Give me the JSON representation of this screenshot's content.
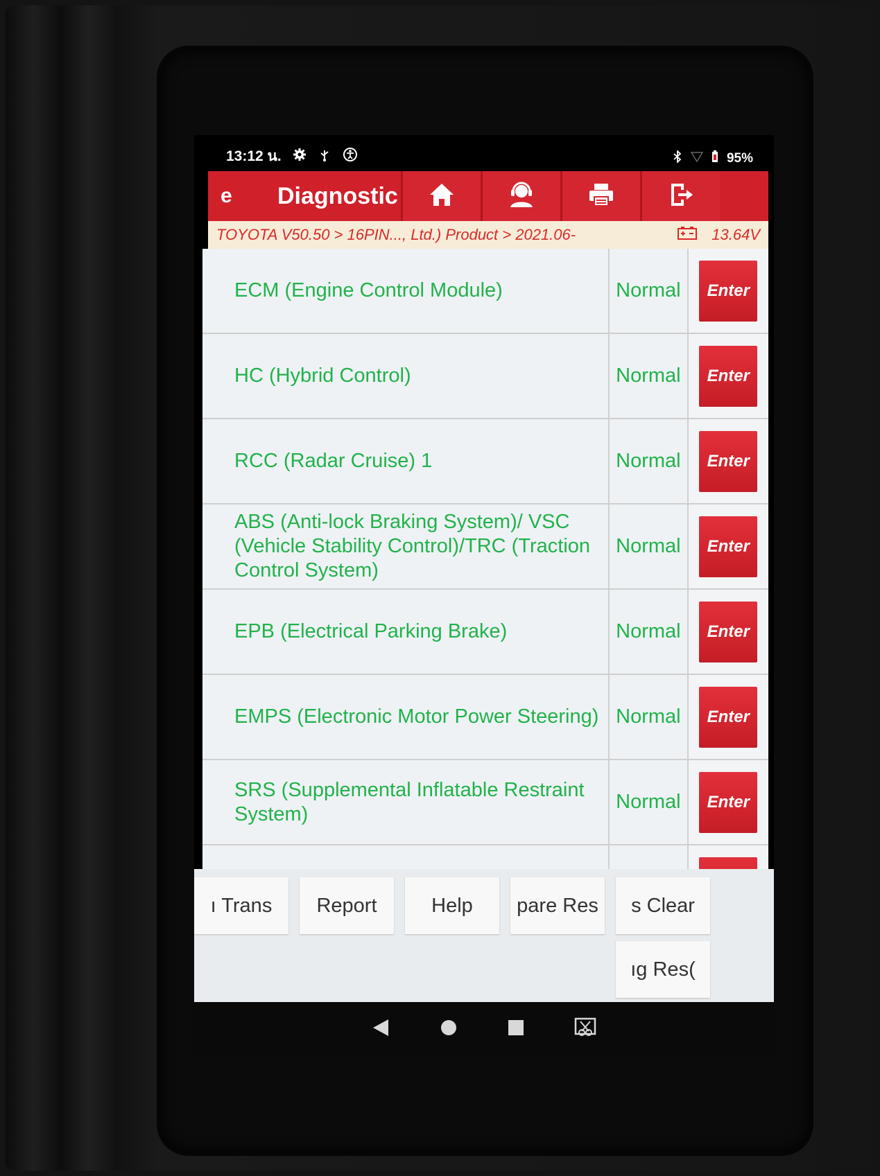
{
  "status_bar": {
    "time": "13:12 น.",
    "battery": "95%"
  },
  "app_bar": {
    "back_fragment": "e",
    "title": "Diagnostic",
    "icons": [
      "home-icon",
      "support-icon",
      "print-icon",
      "exit-icon"
    ]
  },
  "breadcrumb": {
    "path": "TOYOTA V50.50 > 16PIN..., Ltd.) Product > 2021.06-",
    "voltage": "13.64V"
  },
  "systems": [
    {
      "name": "ECM (Engine Control Module)",
      "status": "Normal",
      "action": "Enter"
    },
    {
      "name": "HC (Hybrid Control)",
      "status": "Normal",
      "action": "Enter"
    },
    {
      "name": "RCC (Radar Cruise) 1",
      "status": "Normal",
      "action": "Enter"
    },
    {
      "name": "ABS (Anti-lock Braking System)/ VSC (Vehicle Stability Control)/TRC (Traction Control System)",
      "status": "Normal",
      "action": "Enter"
    },
    {
      "name": "EPB (Electrical Parking Brake)",
      "status": "Normal",
      "action": "Enter"
    },
    {
      "name": "EMPS (Electronic Motor Power Steering)",
      "status": "Normal",
      "action": "Enter"
    },
    {
      "name": "SRS (Supplemental Inflatable Restraint System)",
      "status": "Normal",
      "action": "Enter"
    }
  ],
  "function_buttons": {
    "trans": "ı   Trans",
    "report": "Report",
    "help": "Help",
    "compare": "pare Res",
    "clear": "s   Clear",
    "reset": "ıg   Res("
  },
  "colors": {
    "brand_red": "#d0202a",
    "status_green": "#22b24a"
  }
}
